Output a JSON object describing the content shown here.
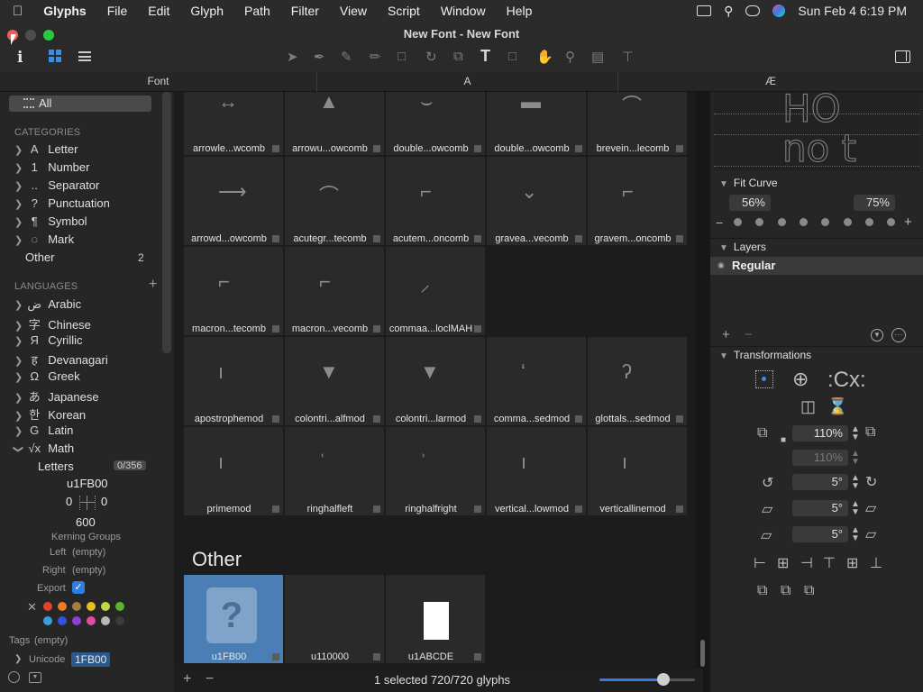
{
  "menubar": {
    "items": [
      "Glyphs",
      "File",
      "Edit",
      "Glyph",
      "Path",
      "Filter",
      "View",
      "Script",
      "Window",
      "Help"
    ],
    "datetime": "Sun Feb 4  6:19 PM"
  },
  "window": {
    "title": "New Font - New Font"
  },
  "tabs": [
    "Font",
    "A",
    "Æ"
  ],
  "sidebar": {
    "all_label": "All",
    "categories_header": "CATEGORIES",
    "categories": [
      {
        "icon": "A",
        "label": "Letter"
      },
      {
        "icon": "1",
        "label": "Number"
      },
      {
        "icon": "..",
        "label": "Separator"
      },
      {
        "icon": "?",
        "label": "Punctuation"
      },
      {
        "icon": "¶",
        "label": "Symbol"
      },
      {
        "icon": "◌",
        "label": "Mark"
      }
    ],
    "other_label": "Other",
    "other_count": "2",
    "languages_header": "LANGUAGES",
    "languages": [
      {
        "icon": "ض",
        "label": "Arabic"
      },
      {
        "icon": "字",
        "label": "Chinese"
      },
      {
        "icon": "Я",
        "label": "Cyrillic"
      },
      {
        "icon": "ह",
        "label": "Devanagari"
      },
      {
        "icon": "Ω",
        "label": "Greek"
      },
      {
        "icon": "あ",
        "label": "Japanese"
      },
      {
        "icon": "한",
        "label": "Korean"
      },
      {
        "icon": "G",
        "label": "Latin"
      },
      {
        "icon": "√x",
        "label": "Math"
      }
    ],
    "math_sub": {
      "label": "Letters",
      "count": "0/356"
    },
    "glyph_info": {
      "name": "u1FB00",
      "lsb": "0",
      "rsb": "0",
      "width": "600",
      "kerning_groups": "Kerning Groups",
      "left_label": "Left",
      "left_value": "(empty)",
      "right_label": "Right",
      "right_value": "(empty)",
      "export_label": "Export",
      "tags_label": "Tags",
      "tags_value": "(empty)",
      "unicode_label": "Unicode",
      "unicode_value": "1FB00"
    },
    "colors": [
      "#e0452b",
      "#ef7a2c",
      "#a87a45",
      "#e3c21f",
      "#c7d646",
      "#58b52e",
      "#3b9ee0",
      "#2f52e0",
      "#8e3fd6",
      "#e04aa0",
      "#b8b8b8",
      "#3c3c3c"
    ]
  },
  "grid": {
    "rows": [
      [
        "arrowle...wcomb",
        "arrowu...owcomb",
        "double...owcomb",
        "double...owcomb",
        "brevein...lecomb"
      ],
      [
        "arrowd...owcomb",
        "acutegr...tecomb",
        "acutem...oncomb",
        "gravea...vecomb",
        "gravem...oncomb"
      ],
      [
        "macron...tecomb",
        "macron...vecomb",
        "commaa...loclMAH"
      ],
      [
        "apostrophemod",
        "colontri...alfmod",
        "colontri...larmod",
        "comma...sedmod",
        "glottals...sedmod"
      ],
      [
        "primemod",
        "ringhalfleft",
        "ringhalfright",
        "vertical...lowmod",
        "verticallinemod"
      ]
    ],
    "section_title": "Other",
    "other_cells": [
      "u1FB00",
      "u110000",
      "u1ABCDE"
    ]
  },
  "statusbar": {
    "text": "1 selected 720/720 glyphs"
  },
  "rightpanel": {
    "preview_top": "HO",
    "preview_bottom": "no t",
    "fit_curve_label": "Fit Curve",
    "fit_curve_left": "56%",
    "fit_curve_right": "75%",
    "layers_label": "Layers",
    "layer_name": "Regular",
    "transformations_label": "Transformations",
    "scale_x": "110%",
    "scale_y": "110%",
    "rotate": "5°",
    "slant_x": "5°",
    "slant_y": "5°"
  }
}
